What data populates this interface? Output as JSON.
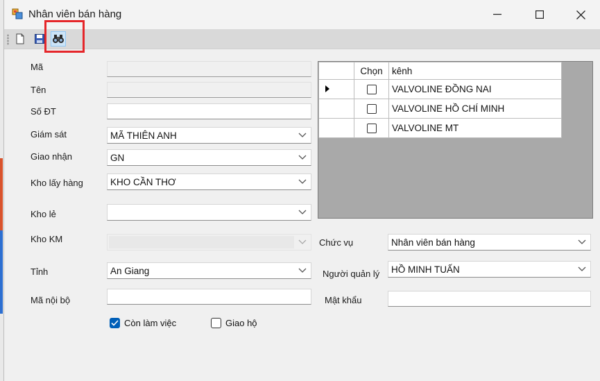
{
  "window": {
    "title": "Nhân viên bán hàng"
  },
  "icons": {
    "app": "app-icon",
    "new": "new-document-icon",
    "save": "save-icon",
    "find": "binoculars-icon",
    "minimize": "minimize-icon",
    "maximize": "maximize-icon",
    "close": "close-icon"
  },
  "colors": {
    "highlight": "#e5262a",
    "accent": "#005fb8"
  },
  "form": {
    "ma_label": "Mã",
    "ma_value": "",
    "ten_label": "Tên",
    "ten_value": "",
    "sodt_label": "Số ĐT",
    "sodt_value": "",
    "giamsat_label": "Giám sát",
    "giamsat_value": "MÃ THIÊN ANH",
    "giaonhan_label": "Giao nhận",
    "giaonhan_value": "GN",
    "kholayhang_label": "Kho lấy hàng",
    "kholayhang_value": "KHO CẦN THƠ",
    "khole_label": "Kho lẻ",
    "khole_value": "",
    "khokm_label": "Kho KM",
    "khokm_value": "",
    "tinh_label": "Tỉnh",
    "tinh_value": "An Giang",
    "manoibo_label": "Mã nội bộ",
    "manoibo_value": "",
    "chucvu_label": "Chức vụ",
    "chucvu_value": "Nhân viên bán hàng",
    "nguoiquanly_label": "Người quản lý",
    "nguoiquanly_value": "HỒ MINH TUẤN",
    "matkhau_label": "Mật khẩu",
    "matkhau_value": "",
    "conlamviec_label": "Còn làm việc",
    "conlamviec_checked": true,
    "giaoho_label": "Giao hộ",
    "giaoho_checked": false
  },
  "grid": {
    "col_chon": "Chọn",
    "col_kenh": "kênh",
    "rows": [
      {
        "kenh": "VALVOLINE ĐỒNG NAI",
        "chon": false,
        "current": true
      },
      {
        "kenh": "VALVOLINE HỒ CHÍ MINH",
        "chon": false,
        "current": false
      },
      {
        "kenh": "VALVOLINE MT",
        "chon": false,
        "current": false
      }
    ]
  }
}
